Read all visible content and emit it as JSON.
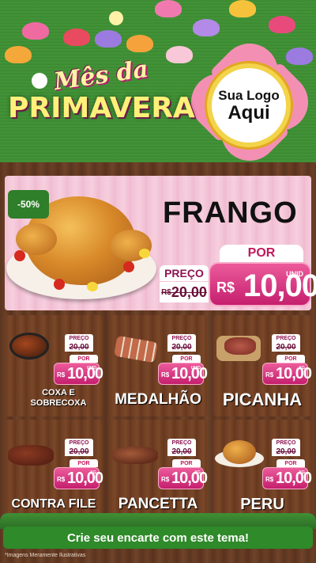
{
  "header": {
    "title_script": "Mês da",
    "title_main": "PRIMAVERA",
    "logo_line1": "Sua Logo",
    "logo_line2": "Aqui"
  },
  "featured": {
    "discount": "-50%",
    "name": "FRANGO",
    "preco_label": "PREÇO",
    "old_currency": "R$",
    "old_price": "20,00",
    "por_label": "POR",
    "new_currency": "R$",
    "new_price": "10,00",
    "unit": "UNID"
  },
  "products": [
    {
      "name": "COXA E SOBRECOXA",
      "preco_label": "PREÇO",
      "old_currency": "R$",
      "old_price": "20,00",
      "por_label": "POR",
      "new_currency": "R$",
      "new_price": "10,00",
      "unit": "UNID"
    },
    {
      "name": "MEDALHÃO",
      "preco_label": "PREÇO",
      "old_currency": "R$",
      "old_price": "20,00",
      "por_label": "POR",
      "new_currency": "R$",
      "new_price": "10,00",
      "unit": "UNID"
    },
    {
      "name": "PICANHA",
      "preco_label": "PREÇO",
      "old_currency": "R$",
      "old_price": "20,00",
      "por_label": "POR",
      "new_currency": "R$",
      "new_price": "10,00",
      "unit": "KG"
    },
    {
      "name": "CONTRA FILE",
      "preco_label": "PREÇO",
      "old_currency": "R$",
      "old_price": "20,00",
      "por_label": "POR",
      "new_currency": "R$",
      "new_price": "10,00",
      "unit": "KG"
    },
    {
      "name": "PANCETTA",
      "preco_label": "PREÇO",
      "old_currency": "R$",
      "old_price": "20,00",
      "por_label": "POR",
      "new_currency": "R$",
      "new_price": "10,00",
      "unit": "KG"
    },
    {
      "name": "PERU",
      "preco_label": "PREÇO",
      "old_currency": "R$",
      "old_price": "20,00",
      "por_label": "POR",
      "new_currency": "R$",
      "new_price": "10,00",
      "unit": "KG"
    }
  ],
  "footer": {
    "cta": "Crie seu encarte com este tema!",
    "disclaimer": "*Imagens Meramente Ilustrativas"
  },
  "colors": {
    "green": "#2f8a2a",
    "pink": "#e0478a",
    "wood": "#6b3c22",
    "yellow": "#fff07a"
  }
}
